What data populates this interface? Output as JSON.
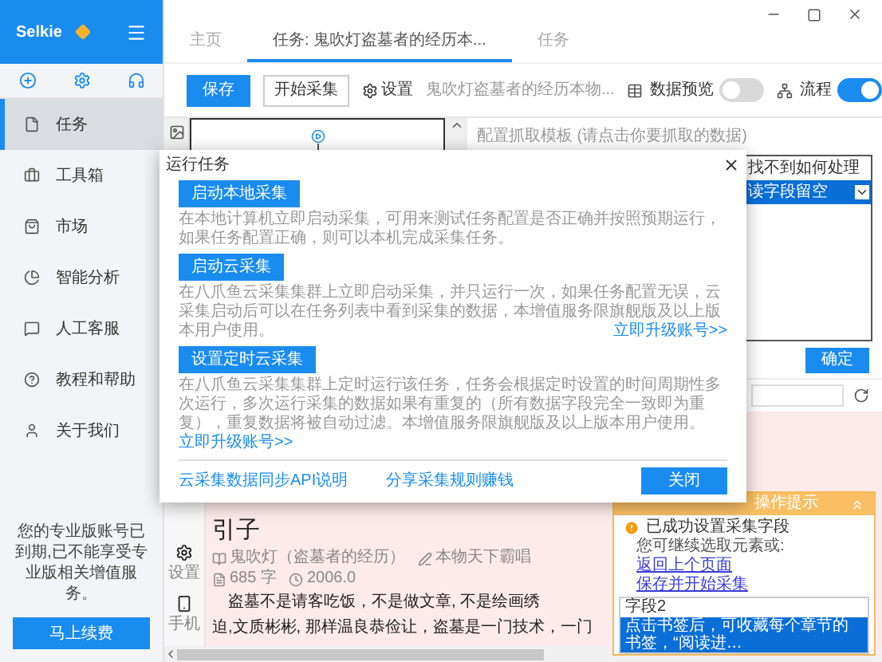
{
  "sidebar": {
    "brand": "Selkie",
    "items": [
      {
        "label": "任务",
        "selected": true
      },
      {
        "label": "工具箱",
        "selected": false
      },
      {
        "label": "市场",
        "selected": false
      },
      {
        "label": "智能分析",
        "selected": false
      },
      {
        "label": "人工客服",
        "selected": false
      },
      {
        "label": "教程和帮助",
        "selected": false
      },
      {
        "label": "关于我们",
        "selected": false
      }
    ],
    "notice": "您的专业版账号已到期,已不能享受专业版相关增值服务。",
    "renew_button": "马上续费"
  },
  "tabs": [
    {
      "label": "主页",
      "selected": false
    },
    {
      "label": "任务: 鬼吹灯盗墓者的经历本...",
      "selected": true
    },
    {
      "label": "任务",
      "selected": false
    }
  ],
  "toolbar": {
    "save_button": "保存",
    "start_button": "开始采集",
    "settings_button": "设置",
    "task_name": "鬼吹灯盗墓者的经历本物...",
    "preview": {
      "label": "数据预览",
      "on": false
    },
    "flow": {
      "label": "流程",
      "on": true
    }
  },
  "template": {
    "title": "配置抓取模板 (请点击你要抓取的数据)",
    "columns": [
      "找不到如何处理"
    ],
    "rows": [
      {
        "cells": [
          "读字段留空"
        ],
        "selected": true
      }
    ]
  },
  "confirm_button": "确定",
  "browser": {
    "side_tools": [
      "设置",
      "手机"
    ],
    "heading": "引子",
    "meta": [
      {
        "kind": "book",
        "text": "鬼吹灯（盗墓者的经历）"
      },
      {
        "kind": "pen",
        "text": "本物天下霸唱"
      },
      {
        "kind": "count",
        "text": "685 字"
      },
      {
        "kind": "clock",
        "text": "2006.0"
      }
    ],
    "lines": [
      "盗墓不是请客吃饭，不是做文章, 不是绘画绣",
      "迫,文质彬彬, 那样温良恭俭让，盗墓是一门技术，一门"
    ]
  },
  "dialog": {
    "title": "运行任务",
    "options": [
      {
        "button": "启动本地采集",
        "description": "在本地计算机立即启动采集，可用来测试任务配置是否正确并按照预期运行，如果任务配置正确，则可以本机完成采集任务。"
      },
      {
        "button": "启动云采集",
        "description": "在八爪鱼云采集集群上立即启动采集，并只运行一次，如果任务配置无误，云采集启动后可以在任务列表中看到采集的数据，本增值服务限旗舰版及以上版本用户使用。",
        "link": "立即升级账号>>",
        "link_inline": false
      },
      {
        "button": "设置定时云采集",
        "description": "在八爪鱼云采集集群上定时运行该任务，任务会根据定时设置的时间周期性多次运行，多次运行采集的数据如果有重复的（所有数据字段完全一致即为重复），重复数据将被自动过滤。本增值服务限旗舰版及以上版本用户使用。",
        "link": "立即升级账号>>",
        "link_inline": true
      }
    ],
    "footer_links": [
      "云采集数据同步API说明",
      "分享采集规则赚钱"
    ],
    "close_button": "关闭"
  },
  "tips": {
    "title": "操作提示",
    "message": "已成功设置采集字段",
    "hint": "您可继续选取元素或:",
    "links": [
      "返回上个页面",
      "保存并开始采集"
    ],
    "field": "字段2",
    "selected_text": "点击书签后，可收藏每个章节的书签，“阅读进…"
  }
}
